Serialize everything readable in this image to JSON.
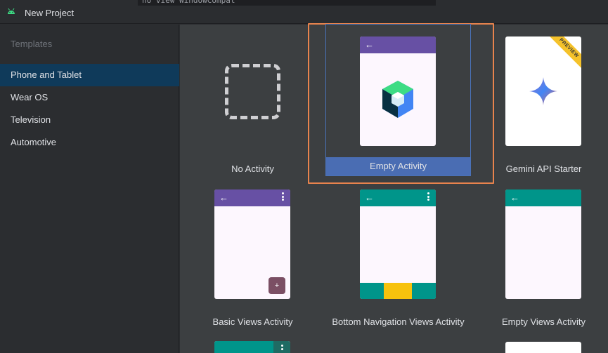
{
  "window": {
    "title": "New Project",
    "background_code": "no view WindowCompat"
  },
  "sidebar": {
    "heading": "Templates",
    "items": [
      {
        "label": "Phone and Tablet",
        "selected": true
      },
      {
        "label": "Wear OS",
        "selected": false
      },
      {
        "label": "Television",
        "selected": false
      },
      {
        "label": "Automotive",
        "selected": false
      }
    ]
  },
  "templates": [
    {
      "label": "No Activity"
    },
    {
      "label": "Empty Activity",
      "selected": true
    },
    {
      "label": "Gemini API Starter",
      "badge": "PREVIEW"
    },
    {
      "label": "Basic Views Activity",
      "fab": "+"
    },
    {
      "label": "Bottom Navigation Views Activity"
    },
    {
      "label": "Empty Views Activity"
    }
  ],
  "icons": {
    "back": "back-arrow-icon",
    "overflow": "overflow-menu-icon",
    "android": "android-icon",
    "compose": "compose-logo-icon",
    "gemini": "gemini-sparkle-icon"
  },
  "colors": {
    "purple_bar": "#6750a4",
    "teal_bar": "#00958a",
    "accent_selected": "#e8834d",
    "selection_blue": "#4a6db3"
  }
}
